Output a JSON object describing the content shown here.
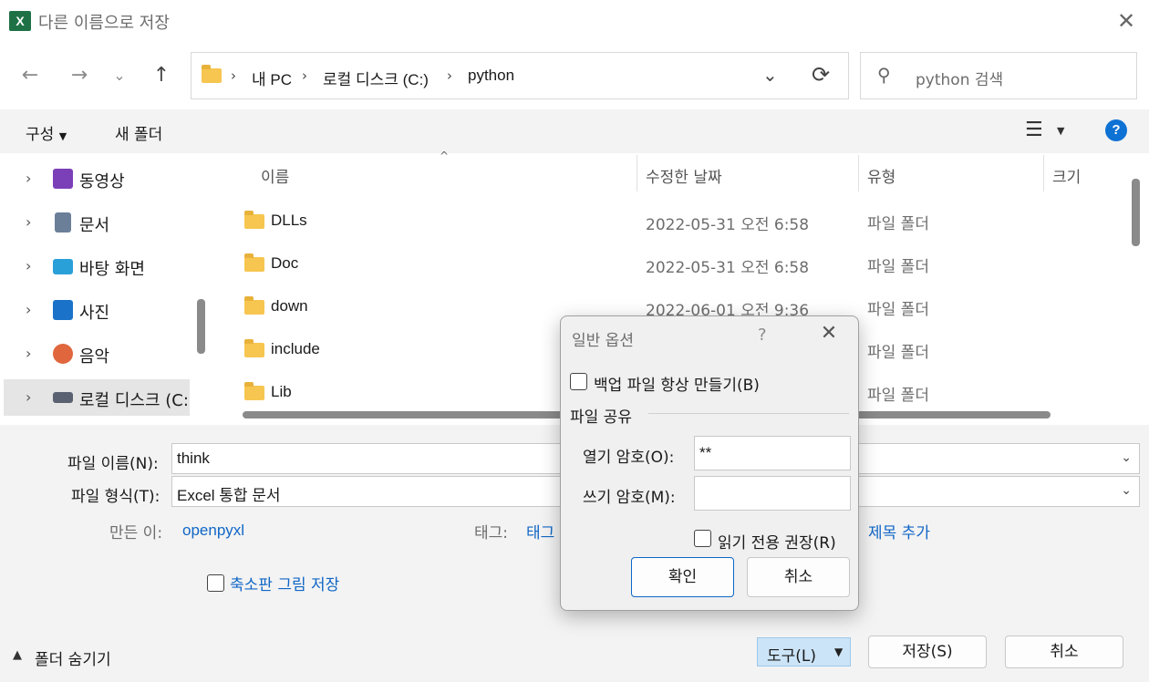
{
  "window": {
    "title": "다른 이름으로 저장",
    "app_icon": "excel-icon"
  },
  "nav": {
    "back": "←",
    "forward": "→",
    "recent": "⌄",
    "up": "↑"
  },
  "address": {
    "crumbs": [
      "내 PC",
      "로컬 디스크 (C:)",
      "python"
    ],
    "refresh": "⟳",
    "dropdown": "⌄"
  },
  "search": {
    "placeholder": "python 검색"
  },
  "toolbar": {
    "organize": "구성",
    "new_folder": "새 폴더"
  },
  "sidebar": {
    "items": [
      {
        "label": "동영상",
        "icon": "video-icon",
        "color": "#7b3fb8"
      },
      {
        "label": "문서",
        "icon": "document-icon",
        "color": "#6b7f99"
      },
      {
        "label": "바탕 화면",
        "icon": "desktop-icon",
        "color": "#2aa0d8"
      },
      {
        "label": "사진",
        "icon": "pictures-icon",
        "color": "#1a73c9"
      },
      {
        "label": "음악",
        "icon": "music-icon",
        "color": "#e0663d"
      },
      {
        "label": "로컬 디스크 (C:",
        "icon": "drive-icon",
        "color": "#5a6170"
      }
    ]
  },
  "columns": {
    "name": "이름",
    "modified": "수정한 날짜",
    "type": "유형",
    "size": "크기"
  },
  "files": [
    {
      "name": "DLLs",
      "modified": "2022-05-31 오전 6:58",
      "type": "파일 폴더"
    },
    {
      "name": "Doc",
      "modified": "2022-05-31 오전 6:58",
      "type": "파일 폴더"
    },
    {
      "name": "down",
      "modified": "2022-06-01 오전 9:36",
      "type": "파일 폴더"
    },
    {
      "name": "include",
      "modified": "",
      "type": "파일 폴더"
    },
    {
      "name": "Lib",
      "modified": "",
      "type": "파일 폴더"
    }
  ],
  "form": {
    "filename_label": "파일 이름(N):",
    "filename_value": "think",
    "filetype_label": "파일 형식(T):",
    "filetype_value": "Excel 통합 문서",
    "author_label": "만든 이:",
    "author_value": "openpyxl",
    "tags_label": "태그:",
    "tags_value": "태그",
    "title_value": "제목 추가",
    "thumbnail_label": "축소판 그림 저장"
  },
  "footer": {
    "hide_folders": "폴더 숨기기",
    "tools": "도구(L)",
    "save": "저장(S)",
    "cancel": "취소"
  },
  "dialog": {
    "title": "일반 옵션",
    "help": "?",
    "backup_label": "백업 파일 항상 만들기(B)",
    "sharing_section": "파일 공유",
    "open_pw_label": "열기 암호(O):",
    "open_pw_value": "**",
    "modify_pw_label": "쓰기 암호(M):",
    "modify_pw_value": "",
    "readonly_label": "읽기 전용 권장(R)",
    "ok": "확인",
    "cancel": "취소"
  }
}
